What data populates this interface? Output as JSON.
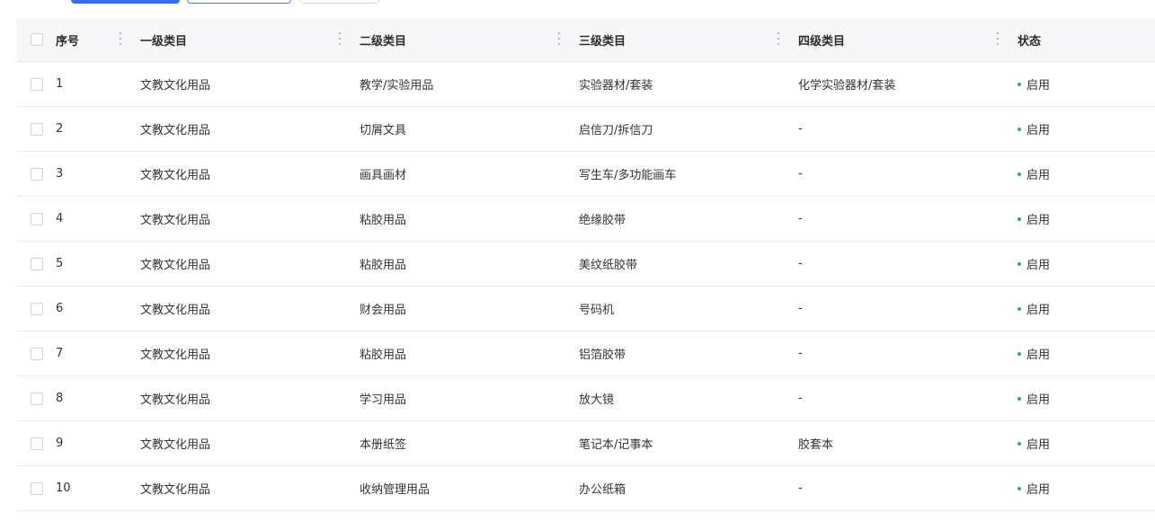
{
  "colors": {
    "primary": "#2f6fed",
    "status_enabled": "#1bb76e",
    "header_bg": "#f7f7f9"
  },
  "table": {
    "headers": {
      "no": "序号",
      "level1": "一级类目",
      "level2": "二级类目",
      "level3": "三级类目",
      "level4": "四级类目",
      "status": "状态"
    },
    "rows": [
      {
        "no": "1",
        "level1": "文教文化用品",
        "level2": "教学/实验用品",
        "level3": "实验器材/套装",
        "level4": "化学实验器材/套装",
        "status": "启用"
      },
      {
        "no": "2",
        "level1": "文教文化用品",
        "level2": "切屑文具",
        "level3": "启信刀/拆信刀",
        "level4": "-",
        "status": "启用"
      },
      {
        "no": "3",
        "level1": "文教文化用品",
        "level2": "画具画材",
        "level3": "写生车/多功能画车",
        "level4": "-",
        "status": "启用"
      },
      {
        "no": "4",
        "level1": "文教文化用品",
        "level2": "粘胶用品",
        "level3": "绝缘胶带",
        "level4": "-",
        "status": "启用"
      },
      {
        "no": "5",
        "level1": "文教文化用品",
        "level2": "粘胶用品",
        "level3": "美纹纸胶带",
        "level4": "-",
        "status": "启用"
      },
      {
        "no": "6",
        "level1": "文教文化用品",
        "level2": "财会用品",
        "level3": "号码机",
        "level4": "-",
        "status": "启用"
      },
      {
        "no": "7",
        "level1": "文教文化用品",
        "level2": "粘胶用品",
        "level3": "铝箔胶带",
        "level4": "-",
        "status": "启用"
      },
      {
        "no": "8",
        "level1": "文教文化用品",
        "level2": "学习用品",
        "level3": "放大镜",
        "level4": "-",
        "status": "启用"
      },
      {
        "no": "9",
        "level1": "文教文化用品",
        "level2": "本册纸签",
        "level3": "笔记本/记事本",
        "level4": "胶套本",
        "status": "启用"
      },
      {
        "no": "10",
        "level1": "文教文化用品",
        "level2": "收纳管理用品",
        "level3": "办公纸箱",
        "level4": "-",
        "status": "启用"
      }
    ]
  }
}
